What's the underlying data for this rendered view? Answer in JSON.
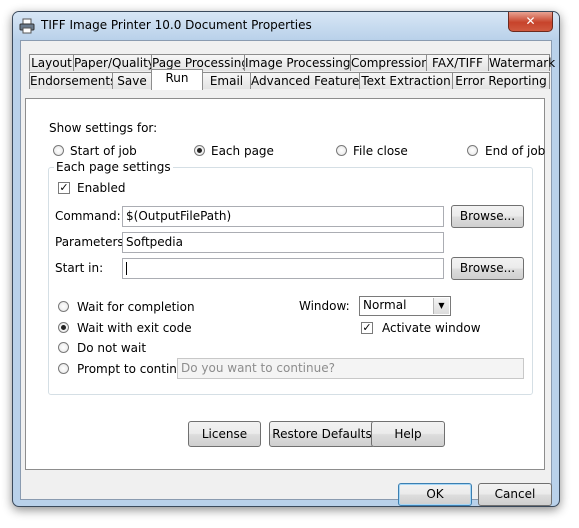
{
  "window": {
    "title": "TIFF Image Printer 10.0 Document Properties",
    "close_glyph": "✕"
  },
  "tabs_row1": [
    "Layout",
    "Paper/Quality",
    "Page Processing",
    "Image Processing",
    "Compression",
    "FAX/TIFF",
    "Watermark"
  ],
  "tabs_row2": [
    "Endorsements",
    "Save",
    "Run",
    "Email",
    "Advanced Features",
    "Text Extraction",
    "Error Reporting"
  ],
  "active_tab": "Run",
  "show_settings": {
    "label": "Show settings for:",
    "options": [
      "Start of job",
      "Each page",
      "File close",
      "End of job"
    ],
    "selected": "Each page"
  },
  "group": {
    "title": "Each page settings",
    "enabled_label": "Enabled",
    "enabled": true,
    "command_label": "Command:",
    "command_value": "$(OutputFilePath)",
    "parameters_label": "Parameters:",
    "parameters_value": "Softpedia",
    "start_in_label": "Start in:",
    "start_in_value": "",
    "browse_label": "Browse...",
    "wait_options": [
      "Wait for completion",
      "Wait with exit code",
      "Do not wait",
      "Prompt to continue:"
    ],
    "wait_selected": "Wait with exit code",
    "prompt_placeholder": "Do you want to continue?",
    "window_label": "Window:",
    "window_value": "Normal",
    "activate_label": "Activate window",
    "activate_checked": true
  },
  "bottom_buttons": {
    "license": "License",
    "restore": "Restore Defaults",
    "help": "Help"
  },
  "dialog_buttons": {
    "ok": "OK",
    "cancel": "Cancel"
  }
}
